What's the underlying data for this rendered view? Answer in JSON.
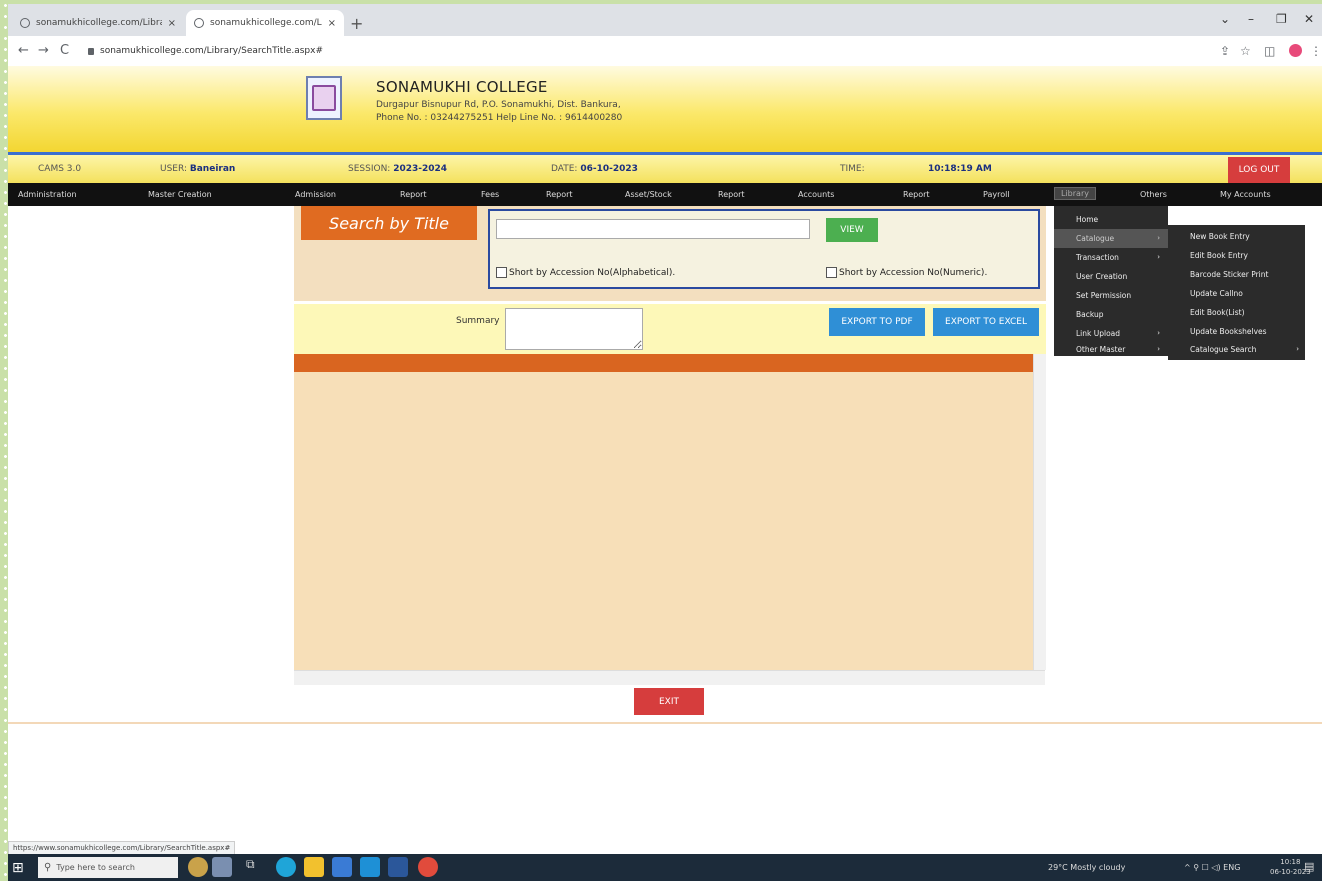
{
  "browser": {
    "tabs": [
      {
        "title": "sonamukhicollege.com/Library/",
        "close": "×"
      },
      {
        "title": "sonamukhicollege.com/Library/",
        "close": "×"
      }
    ],
    "new_tab": "+",
    "window_controls": {
      "minimize": "–",
      "restore": "❐",
      "close": "✕",
      "tab_list": "⌄"
    },
    "nav": {
      "back": "←",
      "forward": "→",
      "reload": "C"
    },
    "url": "sonamukhicollege.com/Library/SearchTitle.aspx#",
    "status_url": "https://www.sonamukhicollege.com/Library/SearchTitle.aspx#"
  },
  "site": {
    "college_name": "SONAMUKHI COLLEGE",
    "address": "Durgapur Bisnupur Rd, P.O. Sonamukhi, Dist. Bankura,",
    "phone": "Phone No. : 03244275251  Help Line No. : 9614400280"
  },
  "infobar": {
    "app_label": "CAMS 3.0",
    "user_label": "USER:",
    "user_value": "Baneiran",
    "session_label": "SESSION:",
    "session_value": "2023-2024",
    "date_label": "DATE:",
    "date_value": "06-10-2023",
    "time_label": "TIME:",
    "time_value": "10:18:19 AM",
    "logout": "LOG OUT"
  },
  "menu": [
    "Administration",
    "Master Creation",
    "Admission",
    "Report",
    "Fees",
    "Report",
    "Asset/Stock",
    "Report",
    "Accounts",
    "Report",
    "Payroll",
    "Library",
    "Others",
    "My Accounts"
  ],
  "library_menu": [
    {
      "label": "Home",
      "arrow": ""
    },
    {
      "label": "Catalogue",
      "arrow": "›"
    },
    {
      "label": "Transaction",
      "arrow": "›"
    },
    {
      "label": "User Creation",
      "arrow": ""
    },
    {
      "label": "Set Permission",
      "arrow": ""
    },
    {
      "label": "Backup",
      "arrow": ""
    },
    {
      "label": "Link Upload",
      "arrow": "›"
    },
    {
      "label": "Other Master",
      "arrow": "›"
    }
  ],
  "catalogue_menu": [
    {
      "label": "New Book Entry",
      "arrow": ""
    },
    {
      "label": "Edit Book Entry",
      "arrow": ""
    },
    {
      "label": "Barcode Sticker Print",
      "arrow": ""
    },
    {
      "label": "Update Callno",
      "arrow": ""
    },
    {
      "label": "Edit Book(List)",
      "arrow": ""
    },
    {
      "label": "Update Bookshelves",
      "arrow": ""
    },
    {
      "label": "Catalogue Search",
      "arrow": "›"
    }
  ],
  "search": {
    "tab_title": "Search by Title",
    "input_value": "",
    "view_button": "VIEW",
    "check_alpha": "Short by Accession No(Alphabetical).",
    "check_numeric": "Short by Accession No(Numeric)."
  },
  "summary": {
    "label": "Summary",
    "value": "",
    "export_pdf": "EXPORT TO PDF",
    "export_excel": "EXPORT TO EXCEL"
  },
  "exit_button": "EXIT",
  "taskbar": {
    "search_placeholder": "Type here to search",
    "weather": "29°C  Mostly cloudy",
    "tray": "^  ⚲  ☐  ◁)  ENG",
    "time": "10:18",
    "date": "06-10-2023"
  }
}
